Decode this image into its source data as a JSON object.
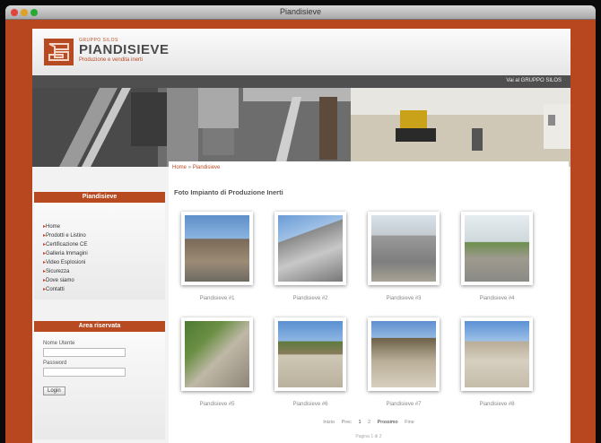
{
  "window": {
    "title": "Piandisieve"
  },
  "header": {
    "brand_group": "GRUPPO SILOS",
    "brand_name": "PIANDISIEVE",
    "brand_tagline": "Produzione e vendita inerti",
    "nav_link": "Vai al GRUPPO SILOS"
  },
  "breadcrumb": {
    "home": "Home",
    "sep": "»",
    "current": "Piandisieve"
  },
  "sidebar": {
    "menu_title": "Piandisieve",
    "menu": [
      "Home",
      "Prodotti e Listino",
      "Certificazione CE",
      "Galleria Immagini",
      "Video Esplosioni",
      "Sicurezza",
      "Dove siamo",
      "Contatti"
    ],
    "login_title": "Area riservata",
    "username_label": "Nome Utente",
    "password_label": "Password",
    "login_button": "Login"
  },
  "main": {
    "title": "Foto Impianto di Produzione Inerti",
    "thumbs": [
      "Piandisieve #1",
      "Piandisieve #2",
      "Piandisieve #3",
      "Piandisieve #4",
      "Piandisieve #5",
      "Piandisieve #6",
      "Piandisieve #7",
      "Piandisieve #8"
    ],
    "pager": {
      "start": "Inizio",
      "prev": "Prec",
      "page1": "1",
      "page2": "2",
      "next": "Prossimo",
      "end": "Fine"
    },
    "page_info": "Pagina 1 di 2"
  }
}
